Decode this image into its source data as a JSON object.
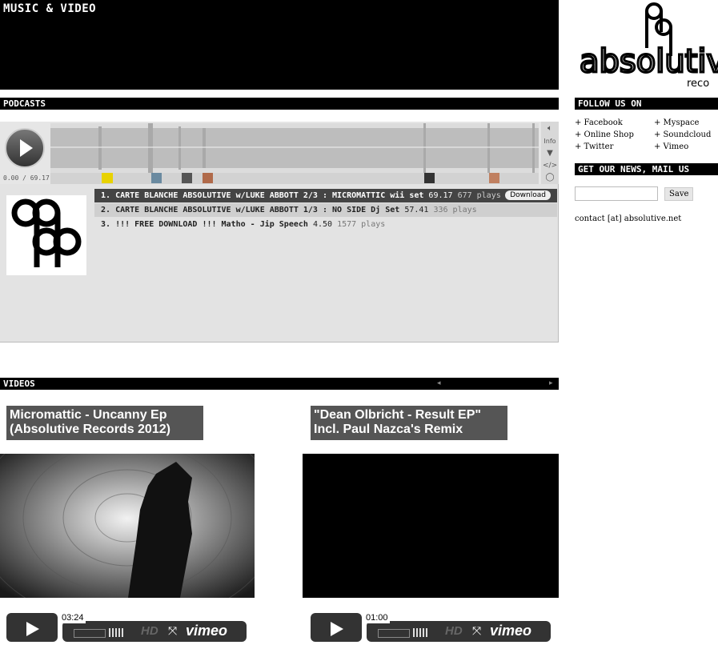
{
  "header": {
    "title": "MUSIC & VIDEO"
  },
  "podcasts": {
    "heading": "PODCASTS",
    "player": {
      "time": "0.00 / 69.17",
      "controls": {
        "info": "Info"
      }
    },
    "tracks": [
      {
        "num": "1.",
        "title": "CARTE BLANCHE ABSOLUTIVE w/LUKE ABBOTT 2/3 : MICROMATTIC wii set",
        "duration": "69.17",
        "plays": "677 plays",
        "download": "Download"
      },
      {
        "num": "2.",
        "title": "CARTE BLANCHE ABSOLUTIVE w/LUKE ABBOTT 1/3 : NO SIDE Dj Set",
        "duration": "57.41",
        "plays": "336 plays"
      },
      {
        "num": "3.",
        "title": "!!! FREE DOWNLOAD !!! Matho -  Jip Speech",
        "duration": "4.50",
        "plays": "1577 plays"
      }
    ]
  },
  "sidebar": {
    "logo_text": "absolutive",
    "logo_sub": "reco",
    "follow_heading": "FOLLOW US ON",
    "social": [
      {
        "label": "+ Facebook"
      },
      {
        "label": "+ Myspace"
      },
      {
        "label": "+ Online Shop"
      },
      {
        "label": "+ Soundcloud"
      },
      {
        "label": "+ Twitter"
      },
      {
        "label": "+ Vimeo"
      }
    ],
    "news_heading": "GET OUR NEWS, MAIL US",
    "email_value": "",
    "save_label": "Save",
    "contact": "contact [at] absolutive.net"
  },
  "videos": {
    "heading": "VIDEOS",
    "items": [
      {
        "title_line1": "Micromattic - Uncanny Ep",
        "title_line2": "(Absolutive Records 2012)",
        "time": "03:24",
        "hd": "HD",
        "brand": "vimeo"
      },
      {
        "title_line1": "\"Dean Olbricht - Result EP\"",
        "title_line2": "Incl. Paul Nazca's Remix",
        "time": "01:00",
        "hd": "HD",
        "brand": "vimeo"
      }
    ]
  },
  "colors": {
    "bar": "#000000",
    "panel": "#e3e3e3",
    "active_track": "#444444",
    "video_title_bg": "#555555"
  }
}
